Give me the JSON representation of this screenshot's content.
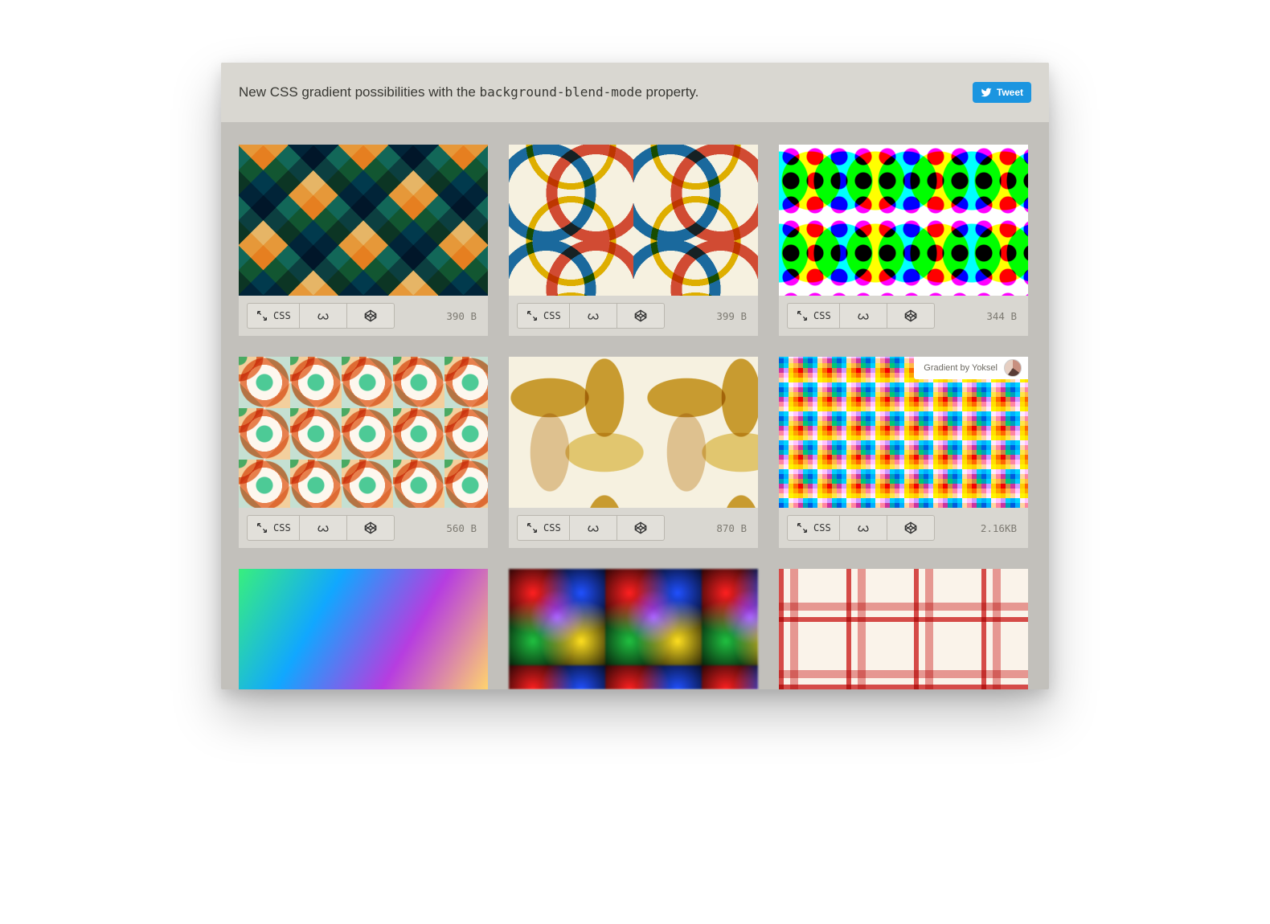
{
  "header": {
    "title_prefix": "New CSS gradient possibilities with the ",
    "title_code": "background-blend-mode",
    "title_suffix": " property.",
    "tweet_label": "Tweet"
  },
  "css_button_label": "CSS",
  "cards": [
    {
      "size": "390 B",
      "credit": null
    },
    {
      "size": "399 B",
      "credit": null
    },
    {
      "size": "344 B",
      "credit": null
    },
    {
      "size": "560 B",
      "credit": null
    },
    {
      "size": "870 B",
      "credit": null
    },
    {
      "size": "2.16KB",
      "credit": "Gradient by Yoksel"
    },
    {
      "size": "",
      "credit": null
    },
    {
      "size": "",
      "credit": null
    },
    {
      "size": "",
      "credit": null
    }
  ]
}
